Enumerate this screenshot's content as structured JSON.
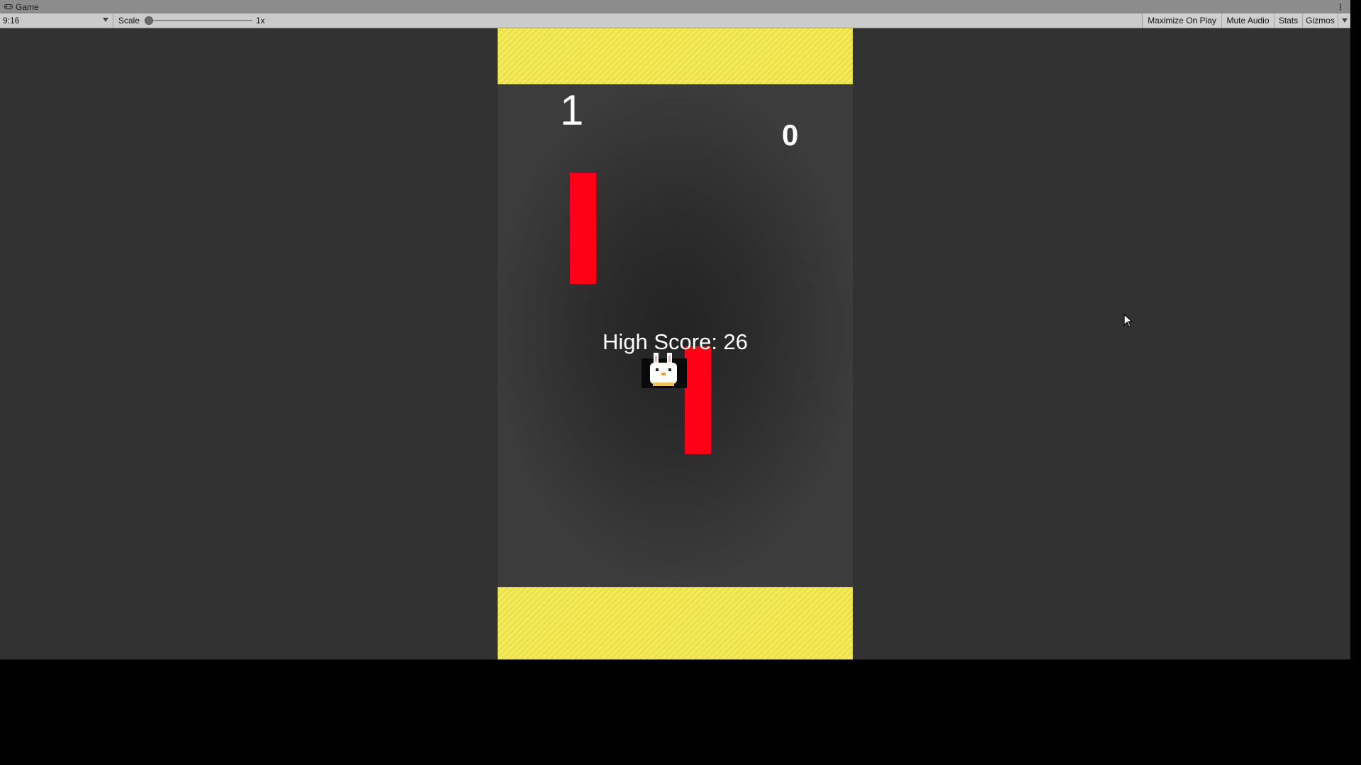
{
  "window": {
    "tab_title": "Game",
    "tab_icon": "gamepad-icon",
    "menu_icon": "kebab-menu-icon"
  },
  "toolbar": {
    "aspect_ratio": "9:16",
    "scale_label": "Scale",
    "scale_value": "1x",
    "maximize_on_play": "Maximize On Play",
    "mute_audio": "Mute Audio",
    "stats": "Stats",
    "gizmos": "Gizmos"
  },
  "game": {
    "score_left": "1",
    "score_right": "0",
    "high_score": "High Score: 26",
    "colors": {
      "band": "#f4e84a",
      "pipe": "#ff0015",
      "background": "#3c3c3c"
    },
    "player_icon": "bunny-sprite"
  }
}
